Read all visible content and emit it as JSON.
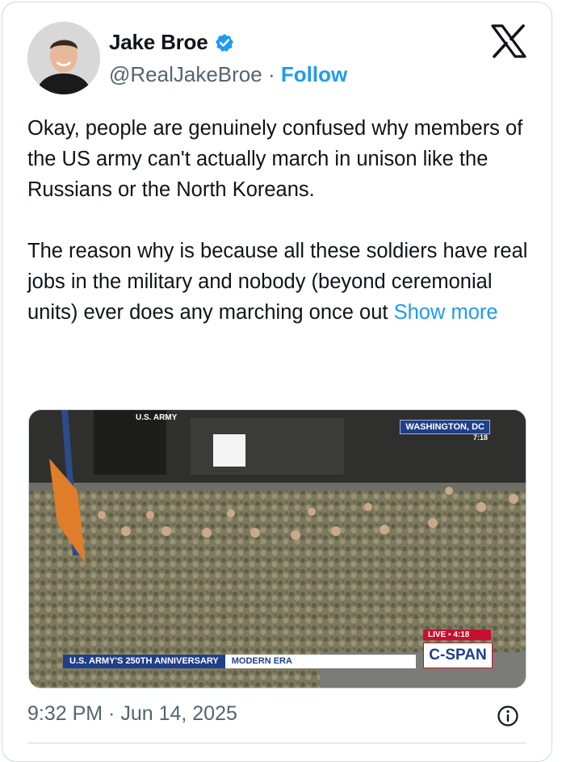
{
  "author": {
    "name": "Jake Broe",
    "handle": "@RealJakeBroe",
    "separator": "·",
    "follow_label": "Follow",
    "verified_icon": "verified-badge-icon",
    "avatar_icon": "avatar"
  },
  "platform_logo": "x-logo-icon",
  "tweet": {
    "paragraph1": "Okay, people are genuinely confused why members of the US army can't actually march in unison like the Russians or the North Koreans.",
    "paragraph2": "The reason why is because all these soldiers have real jobs in the military and nobody (beyond ceremonial units) ever does any marching once out",
    "show_more": "Show more"
  },
  "media": {
    "location_label": "WASHINGTON, DC",
    "time_label": "7:18",
    "banner_title": "U.S. ARMY'S 250TH ANNIVERSARY",
    "banner_subtitle": "MODERN ERA",
    "live_label": "LIVE",
    "live_time": "4:18",
    "network_label": "C-SPAN",
    "sign_label": "U.S. ARMY"
  },
  "timestamp": "9:32 PM · Jun 14, 2025",
  "info_icon": "info-icon",
  "colors": {
    "accent": "#1d9bf0",
    "secondary_text": "#536471",
    "border": "#cfd9de"
  }
}
